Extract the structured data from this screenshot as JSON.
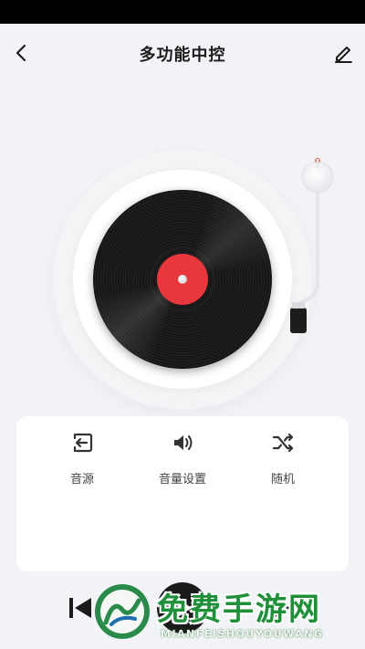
{
  "header": {
    "title": "多功能中控",
    "back_icon": "chevron-left-icon",
    "edit_icon": "pencil-icon"
  },
  "player": {
    "record_label_color": "#e8373d",
    "accent": "#1b1b1b"
  },
  "functions": [
    {
      "label": "音源",
      "icon": "input-source-icon"
    },
    {
      "label": "音量设置",
      "icon": "speaker-volume-icon"
    },
    {
      "label": "随机",
      "icon": "shuffle-icon"
    }
  ],
  "controls": {
    "prev_icon": "skip-previous-icon",
    "play_icon": "play-pause-icon",
    "next_icon": "skip-next-icon"
  },
  "watermark": {
    "title": "免费手游网",
    "subtitle": "MIANFEISHOUYOUWANG"
  }
}
